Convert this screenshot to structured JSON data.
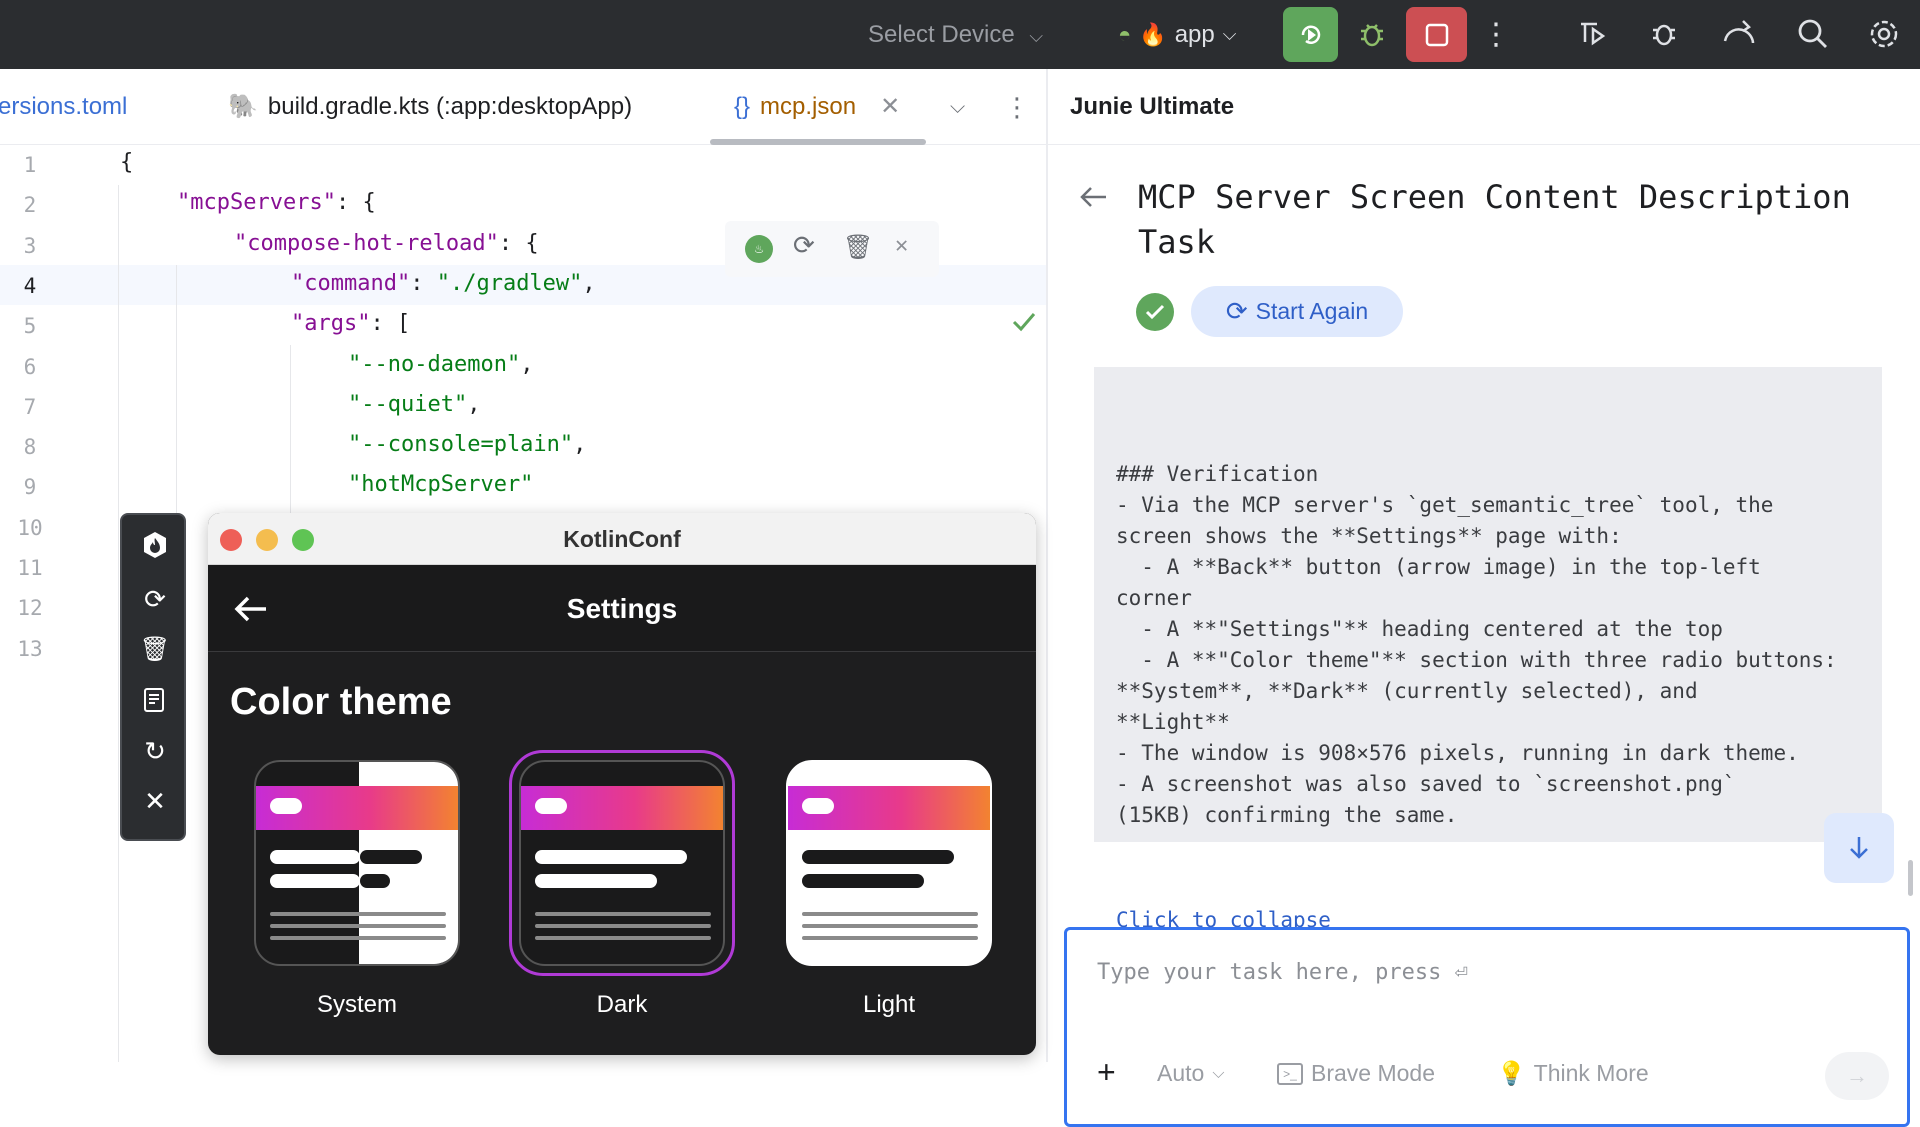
{
  "toolbar": {
    "device_select": "Select Device",
    "run_config": "app",
    "icons": [
      "android-icon",
      "fire-icon",
      "rerun-icon",
      "debug-bug-icon",
      "stop-icon",
      "more-vertical-icon",
      "profile-icon",
      "debug-attach-icon",
      "sync-gradle-icon",
      "search-icon",
      "settings-gear-icon"
    ]
  },
  "tabs": [
    {
      "label": "versions.toml"
    },
    {
      "label": "build.gradle.kts (:app:desktopApp)"
    },
    {
      "label": "mcp.json",
      "active": true
    }
  ],
  "editor": {
    "line_numbers": [
      "1",
      "2",
      "3",
      "4",
      "5",
      "6",
      "7",
      "8",
      "9",
      "10",
      "11",
      "12",
      "13"
    ],
    "lines": [
      {
        "indent": 0,
        "parts": [
          {
            "t": "{",
            "c": "punc"
          }
        ]
      },
      {
        "indent": 1,
        "parts": [
          {
            "t": "\"mcpServers\"",
            "c": "key"
          },
          {
            "t": ": {",
            "c": "punc"
          }
        ]
      },
      {
        "indent": 2,
        "parts": [
          {
            "t": "\"compose-hot-reload\"",
            "c": "key"
          },
          {
            "t": ": {",
            "c": "punc"
          }
        ]
      },
      {
        "indent": 3,
        "parts": [
          {
            "t": "\"command\"",
            "c": "key"
          },
          {
            "t": ": ",
            "c": "punc"
          },
          {
            "t": "\"./gradlew\"",
            "c": "str"
          },
          {
            "t": ",",
            "c": "punc"
          }
        ]
      },
      {
        "indent": 3,
        "parts": [
          {
            "t": "\"args\"",
            "c": "key"
          },
          {
            "t": ": [",
            "c": "punc"
          }
        ]
      },
      {
        "indent": 4,
        "parts": [
          {
            "t": "\"--no-daemon\"",
            "c": "str"
          },
          {
            "t": ",",
            "c": "punc"
          }
        ]
      },
      {
        "indent": 4,
        "parts": [
          {
            "t": "\"--quiet\"",
            "c": "str"
          },
          {
            "t": ",",
            "c": "punc"
          }
        ]
      },
      {
        "indent": 4,
        "parts": [
          {
            "t": "\"--console=plain\"",
            "c": "str"
          },
          {
            "t": ",",
            "c": "punc"
          }
        ]
      },
      {
        "indent": 4,
        "parts": [
          {
            "t": "\"hotMcpServer\"",
            "c": "str"
          }
        ]
      }
    ]
  },
  "junie": {
    "panel_title": "Junie Ultimate",
    "task_title": "MCP Server Screen Content Description Task",
    "start_again": "Start Again",
    "verification": [
      "### Verification",
      "- Via the MCP server's `get_semantic_tree` tool, the",
      "screen shows the **Settings** page with:",
      "  - A **Back** button (arrow image) in the top-left",
      "corner",
      "  - A **\"Settings\"** heading centered at the top",
      "  - A **\"Color theme\"** section with three radio buttons:",
      "**System**, **Dark** (currently selected), and",
      "**Light**",
      "- The window is 908×576 pixels, running in dark theme.",
      "- A screenshot was also saved to `screenshot.png`",
      "(15KB) confirming the same."
    ],
    "collapse_link": "Click to collapse",
    "input_placeholder": "Type your task here, press ⏎",
    "model_select": "Auto",
    "brave_mode": "Brave Mode",
    "think_more": "Think More"
  },
  "kotlinconf": {
    "window_title": "KotlinConf",
    "screen_title": "Settings",
    "section_heading": "Color theme",
    "themes": [
      {
        "label": "System"
      },
      {
        "label": "Dark",
        "selected": true
      },
      {
        "label": "Light"
      }
    ],
    "accent": "#b03ad6"
  }
}
